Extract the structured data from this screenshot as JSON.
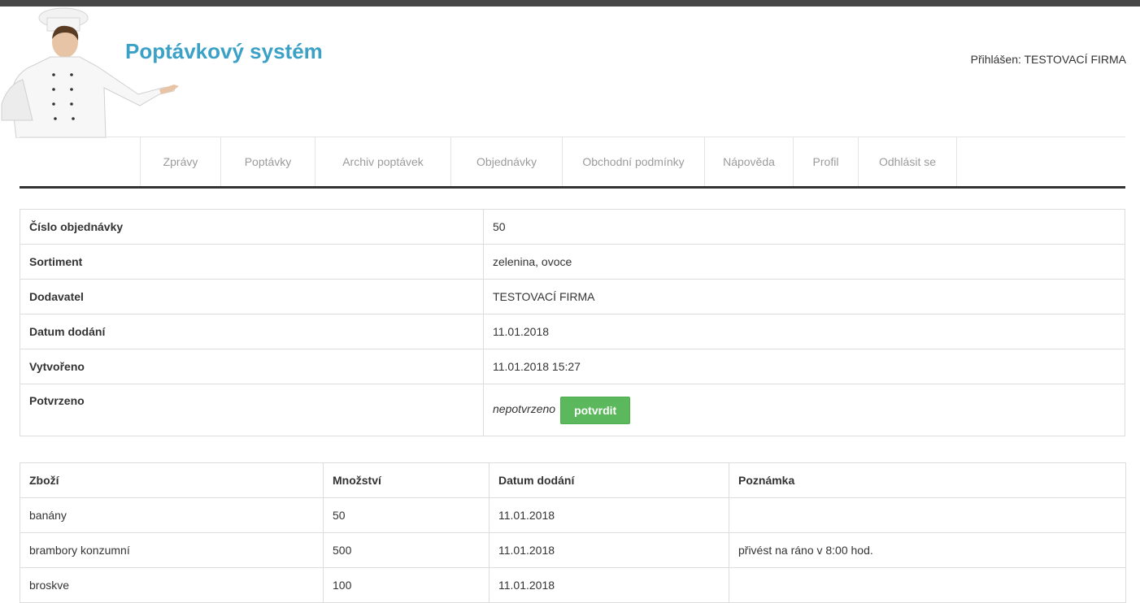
{
  "header": {
    "title": "Poptávkový systém",
    "user_info": "Přihlášen: TESTOVACÍ FIRMA"
  },
  "nav": {
    "items": [
      {
        "label": "Zprávy"
      },
      {
        "label": "Poptávky"
      },
      {
        "label": "Archiv poptávek"
      },
      {
        "label": "Objednávky"
      },
      {
        "label": "Obchodní podmínky"
      },
      {
        "label": "Nápověda"
      },
      {
        "label": "Profil"
      },
      {
        "label": "Odhlásit se"
      }
    ]
  },
  "order": {
    "rows": [
      {
        "key": "Číslo objednávky",
        "value": "50"
      },
      {
        "key": "Sortiment",
        "value": "zelenina, ovoce"
      },
      {
        "key": "Dodavatel",
        "value": "TESTOVACÍ FIRMA"
      },
      {
        "key": "Datum dodání",
        "value": "11.01.2018"
      },
      {
        "key": "Vytvořeno",
        "value": "11.01.2018 15:27"
      }
    ],
    "confirmed_label": "Potvrzeno",
    "confirmed_status": "nepotvrzeno",
    "confirm_button": "potvrdit"
  },
  "items": {
    "headers": [
      "Zboží",
      "Množství",
      "Datum dodání",
      "Poznámka"
    ],
    "rows": [
      [
        "banány",
        "50",
        "11.01.2018",
        ""
      ],
      [
        "brambory konzumní",
        "500",
        "11.01.2018",
        "přivést na ráno v 8:00 hod."
      ],
      [
        "broskve",
        "100",
        "11.01.2018",
        ""
      ]
    ]
  },
  "colors": {
    "brand": "#3ba1c6",
    "confirm_button": "#5cb85c",
    "nav_text": "#9b9b9b",
    "topbar": "#474747"
  }
}
